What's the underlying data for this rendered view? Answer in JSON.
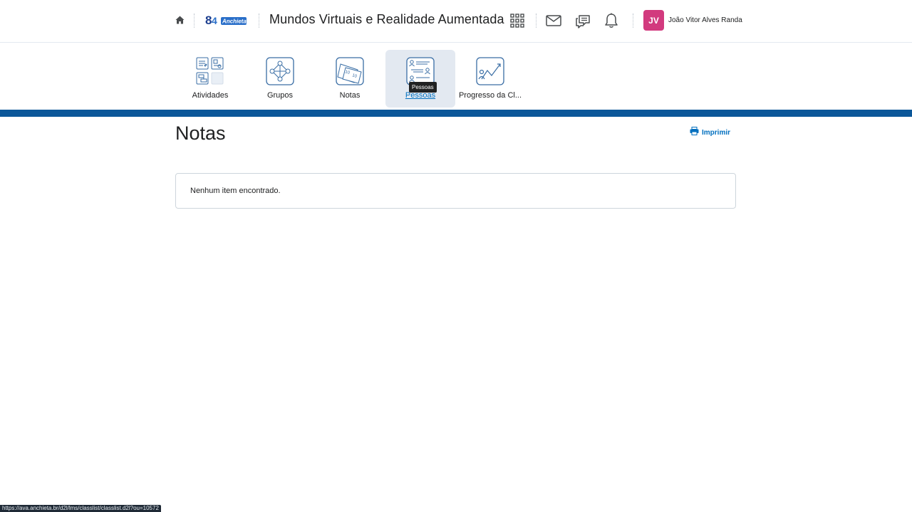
{
  "header": {
    "course_title": "Mundos Virtuais e Realidade Aumentada",
    "logo_text": "84 Anchieta",
    "icons": {
      "home": "home-icon",
      "apps": "waffle-grid-icon",
      "mail": "mail-icon",
      "chat": "chat-icon",
      "notifications": "bell-icon"
    },
    "user": {
      "initials": "JV",
      "name": "João Vitor Alves Randa",
      "avatar_color": "#d23a7e"
    }
  },
  "nav": {
    "items": [
      {
        "label": "Atividades",
        "icon": "activities-icon"
      },
      {
        "label": "Grupos",
        "icon": "groups-icon"
      },
      {
        "label": "Notas",
        "icon": "grades-icon"
      },
      {
        "label": "Pessoas",
        "icon": "people-icon",
        "active": true
      },
      {
        "label": "Progresso da Cl...",
        "icon": "progress-chart-icon"
      }
    ],
    "tooltip": "Pessoas",
    "band_color": "#0b5799"
  },
  "main": {
    "title": "Notas",
    "print_label": "Imprimir",
    "empty_message": "Nenhum item encontrado."
  },
  "status_bar": {
    "url": "https://ava.anchieta.br/d2l/lms/classlist/classlist.d2l?ou=10572"
  },
  "colors": {
    "accent": "#006fbf",
    "icon_stroke": "#3a6ea5"
  }
}
